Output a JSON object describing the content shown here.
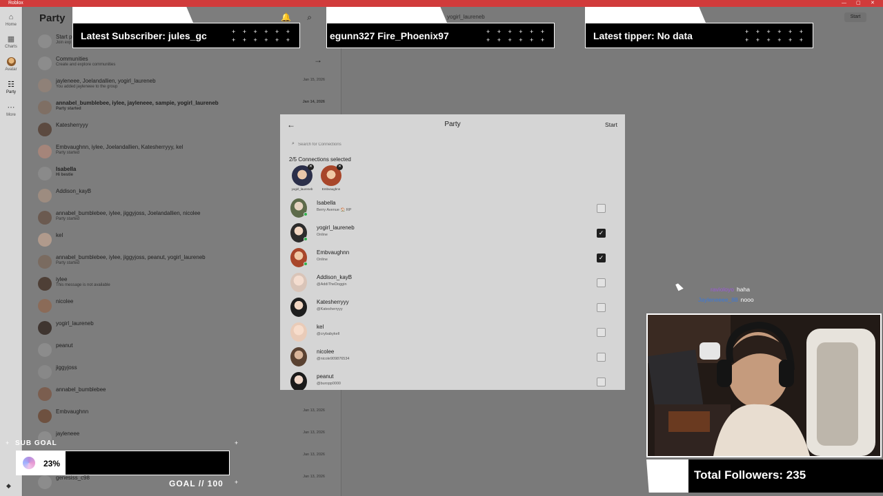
{
  "window": {
    "title": "Roblox",
    "controls": [
      "—",
      "▢",
      "✕"
    ]
  },
  "rail": [
    {
      "label": "Home",
      "icon": "⌂"
    },
    {
      "label": "Charts",
      "icon": "▦"
    },
    {
      "label": "Avatar",
      "icon": "●"
    },
    {
      "label": "Party",
      "icon": "☷"
    },
    {
      "label": "More",
      "icon": "⋯"
    }
  ],
  "party": {
    "title": "Party",
    "tools": "🔔 ⌕ +",
    "start_party": {
      "name": "Start p",
      "sub": "Join exp"
    },
    "communities": {
      "name": "Communities",
      "sub": "Create and explore communities"
    },
    "conversations": [
      {
        "name": "jayleneee, Joelandallien, yogirl_laureneb",
        "sub": "You added jayleneee to the group",
        "date": "Jan 15, 2026",
        "bold": false
      },
      {
        "name": "annabel_bumblebee, iylee, jayleneee, sampie, yogirl_laureneb",
        "sub": "Party started",
        "date": "Jan 14, 2026",
        "bold": true
      },
      {
        "name": "Katesherryyy",
        "sub": "",
        "date": "",
        "bold": false
      },
      {
        "name": "Embvaughnn, iylee, Joelandallien, Katesherryyy, kel",
        "sub": "Party started",
        "date": "",
        "bold": false
      },
      {
        "name": "Isabella",
        "sub": "Hi bestie",
        "date": "",
        "bold": true
      },
      {
        "name": "Addison_kayB",
        "sub": "",
        "date": "",
        "bold": false
      },
      {
        "name": "annabel_bumblebee, iylee, jiggyjoss, Joelandallien, nicolee",
        "sub": "Party started",
        "date": "",
        "bold": false
      },
      {
        "name": "kel",
        "sub": "",
        "date": "",
        "bold": false
      },
      {
        "name": "annabel_bumblebee, iylee, jiggyjoss, peanut, yogirl_laureneb",
        "sub": "Party started",
        "date": "",
        "bold": false
      },
      {
        "name": "iylee",
        "sub": "This message is not available",
        "date": "",
        "bold": false
      },
      {
        "name": "nicolee",
        "sub": "",
        "date": "",
        "bold": false
      },
      {
        "name": "yogirl_laureneb",
        "sub": "",
        "date": "",
        "bold": false
      },
      {
        "name": "peanut",
        "sub": "",
        "date": "",
        "bold": false
      },
      {
        "name": "jiggyjoss",
        "sub": "",
        "date": "",
        "bold": false
      },
      {
        "name": "annabel_bumblebee",
        "sub": "",
        "date": "",
        "bold": false
      },
      {
        "name": "Embvaughnn",
        "sub": "",
        "date": "Jan 13, 2026",
        "bold": false
      },
      {
        "name": "jayleneee",
        "sub": "",
        "date": "Jan 13, 2026",
        "bold": false
      },
      {
        "name": "",
        "sub": "",
        "date": "Jan 13, 2026",
        "bold": false
      },
      {
        "name": "genesiss_c98",
        "sub": "",
        "date": "Jan 13, 2026",
        "bold": false
      }
    ],
    "center_name": "yogirl_laureneb",
    "start_button": "Start"
  },
  "modal": {
    "back": "←",
    "title": "Party",
    "start": "Start",
    "search_placeholder": "Search for Connections",
    "selected_count": "2/5 Connections selected",
    "selected": [
      {
        "name": "yogirl_laureneb",
        "remove": "✕"
      },
      {
        "name": "Embvaughnn",
        "remove": "✕"
      }
    ],
    "connections": [
      {
        "name": "Isabella",
        "sub": "Berry Avenue 🏠 RP",
        "online": true,
        "checked": false
      },
      {
        "name": "yogirl_laureneb",
        "sub": "Online",
        "online": true,
        "checked": true
      },
      {
        "name": "Embvaughnn",
        "sub": "Online",
        "online": true,
        "checked": true
      },
      {
        "name": "Addison_kayB",
        "sub": "@AddiTheDoggin",
        "online": false,
        "checked": false
      },
      {
        "name": "Katesherryyy",
        "sub": "@Katesherryyy",
        "online": false,
        "checked": false
      },
      {
        "name": "kel",
        "sub": "@crybabykell",
        "online": false,
        "checked": false
      },
      {
        "name": "nicolee",
        "sub": "@nicole909876534",
        "online": false,
        "checked": false
      },
      {
        "name": "peanut",
        "sub": "@buropp0000",
        "online": false,
        "checked": false
      }
    ],
    "check_glyph": "✓"
  },
  "overlay": {
    "latest_subscriber": "Latest Subscriber: jules_gc",
    "ticker": "egunn327    Fire_Phoenix97",
    "latest_tipper": "Latest tipper: No data",
    "dots": "+ + + + + +\n+ + + + + +",
    "chat": [
      {
        "user": "ravioloyo",
        "message": "haha"
      },
      {
        "user": "Jayleneeee_88",
        "message": "nooo"
      }
    ],
    "total_followers": "Total Followers: 235",
    "sub_goal_label": "SUB GOAL",
    "sub_goal_percent": "23%",
    "sub_goal_fraction": 0.23,
    "goal_text": "GOAL // 100"
  },
  "colors": {
    "titlebar": "#d13b3b",
    "online": "#2fb24c",
    "chat_user_1": "#9b59d8",
    "chat_user_2": "#3b78d8"
  }
}
